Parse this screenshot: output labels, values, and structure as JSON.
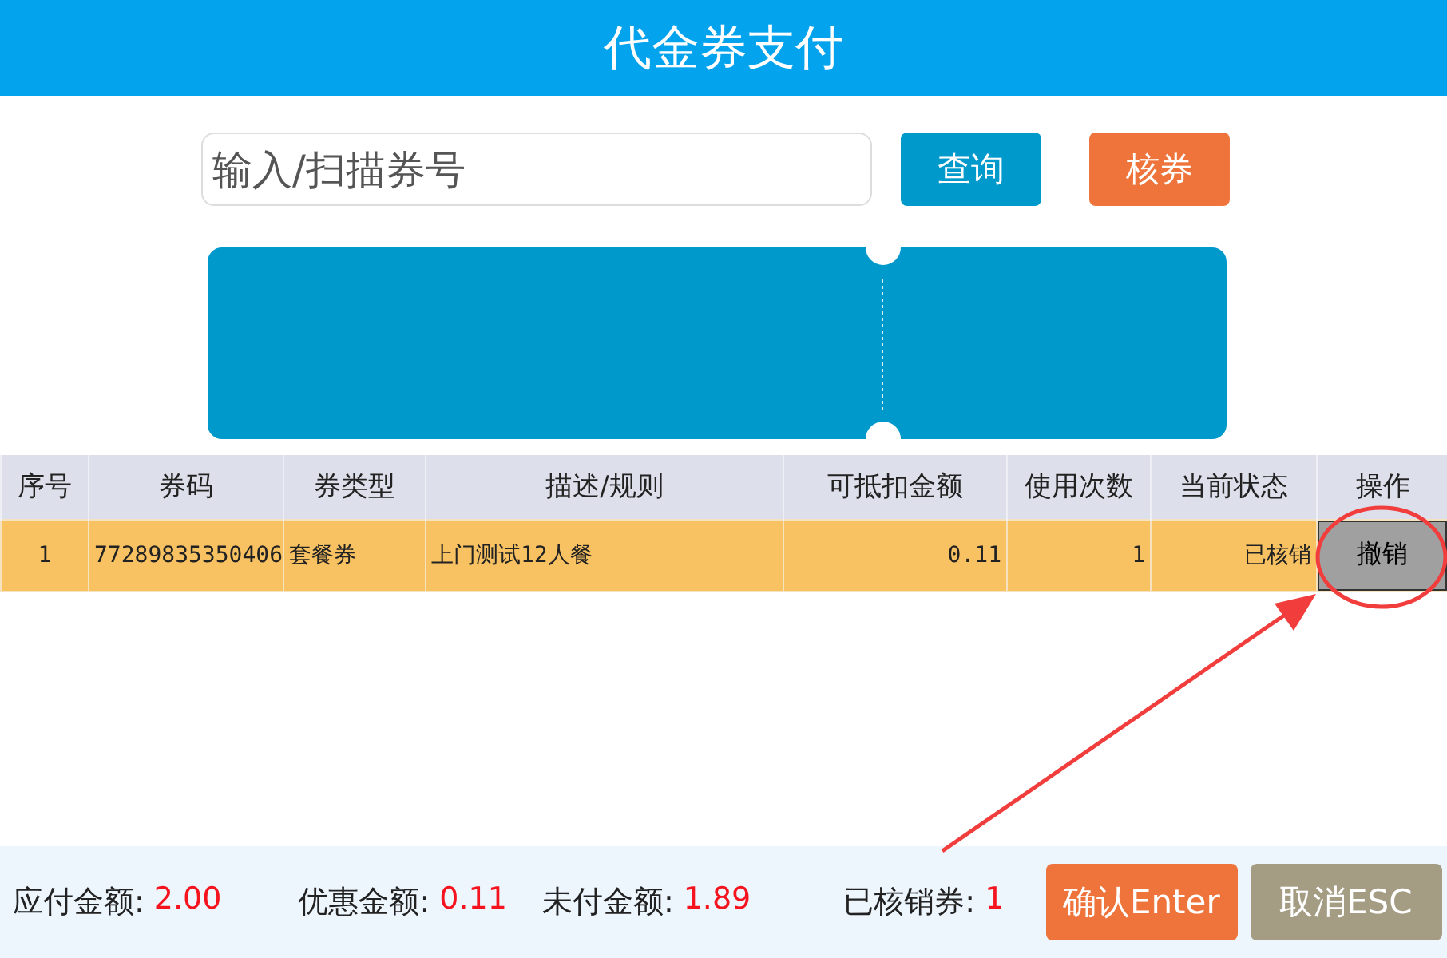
{
  "window": {
    "title": "代金券支付"
  },
  "search": {
    "placeholder": "输入/扫描券号",
    "buttons": [
      {
        "label": "查询",
        "kind": "primary"
      },
      {
        "label": "核券",
        "kind": "warning"
      }
    ]
  },
  "table": {
    "columns": [
      "序号",
      "券码",
      "券类型",
      "描述/规则",
      "可抵扣金额",
      "使用次数",
      "当前状态",
      "操作"
    ],
    "rows": [
      {
        "selected": true,
        "cells": [
          "1",
          "77289835350406",
          "套餐券",
          "上门测试12人餐",
          "0.11",
          "1",
          "已核销"
        ],
        "action": "撤销"
      }
    ]
  },
  "summary": [
    {
      "label": "应付金额:",
      "value": "2.00"
    },
    {
      "label": "优惠金额:",
      "value": "0.11"
    },
    {
      "label": "未付金额:",
      "value": "1.89"
    },
    {
      "label": "已核销券:",
      "value": "1"
    }
  ],
  "footer_buttons": [
    {
      "label": "确认Enter",
      "kind": "confirm"
    },
    {
      "label": "取消ESC",
      "kind": "cancel"
    }
  ]
}
